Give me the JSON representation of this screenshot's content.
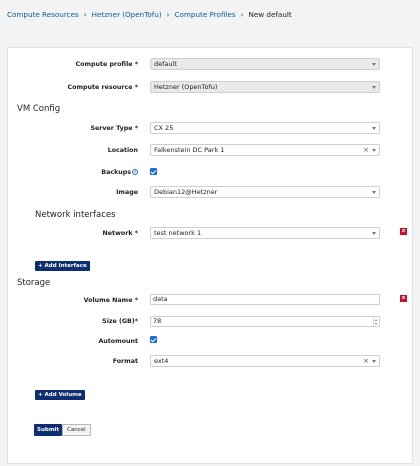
{
  "breadcrumb": {
    "items": [
      "Compute Resources",
      "Hetzner (OpenTofu)",
      "Compute Profiles"
    ],
    "current": "New default",
    "separator": "›"
  },
  "form": {
    "compute_profile": {
      "label": "Compute profile *",
      "value": "default"
    },
    "compute_resource": {
      "label": "Compute resource *",
      "value": "Hetzner (OpenTofu)"
    },
    "vm_config": {
      "title": "VM Config",
      "server_type": {
        "label": "Server Type *",
        "value": "CX 25"
      },
      "location": {
        "label": "Location",
        "value": "Falkenstein DC Park 1"
      },
      "backups": {
        "label": "Backups",
        "checked": true,
        "icon": "info-icon"
      },
      "image": {
        "label": "Image",
        "value": "Debian12@Hetzner"
      }
    },
    "network": {
      "title": "Network interfaces",
      "network_field": {
        "label": "Network *",
        "value": "test network 1"
      },
      "delete_label": "x",
      "add_label": "+ Add Interface"
    },
    "storage": {
      "title": "Storage",
      "volume_name": {
        "label": "Volume Name *",
        "value": "data"
      },
      "size": {
        "label": "Size (GB)*",
        "value": "78"
      },
      "automount": {
        "label": "Automount",
        "checked": true
      },
      "format": {
        "label": "Format",
        "value": "ext4"
      },
      "delete_label": "x",
      "add_label": "+ Add Volume"
    },
    "submit_label": "Submit",
    "cancel_label": "Cancel"
  },
  "colors": {
    "primary": "#0d2e70",
    "danger": "#c8102e",
    "link": "#0b5fa0",
    "checkbox": "#1b6fd6"
  }
}
